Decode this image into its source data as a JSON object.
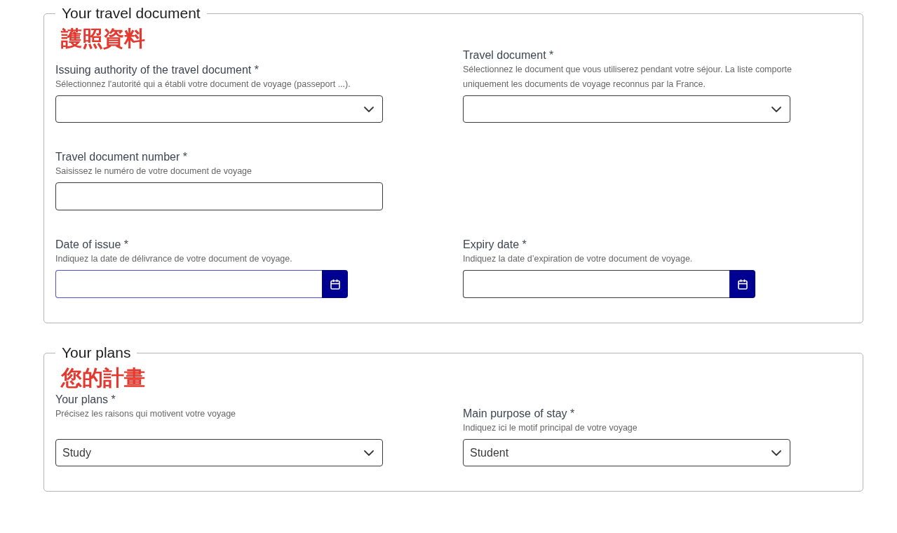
{
  "sections": [
    {
      "legend": "Your travel document",
      "annotation": "護照資料",
      "rows": [
        [
          {
            "kind": "select",
            "label": "Issuing authority of the travel document *",
            "hint": "Sélectionnez l'autorité qui a établi votre document de voyage (passeport ...).",
            "focused": false
          },
          {
            "kind": "select",
            "label": "Travel document *",
            "hint": "Sélectionnez le document que vous utiliserez pendant votre séjour. La liste comporte uniquement les documents de voyage reconnus par la France.",
            "focused": false
          }
        ],
        [
          {
            "kind": "text",
            "label": "Travel document number *",
            "hint": "Saisissez le numéro de votre document de voyage",
            "focused": false
          }
        ],
        [
          {
            "kind": "date",
            "label": "Date of issue *",
            "hint": "Indiquez la date de délivrance de votre document de voyage.",
            "focused": true
          },
          {
            "kind": "date",
            "label": "Expiry date *",
            "hint": "Indiquez la date d’expiration de votre document de voyage.",
            "focused": false
          }
        ]
      ]
    },
    {
      "legend": "Your plans",
      "annotation": "您的計畫",
      "rows": [
        [
          {
            "kind": "select",
            "label": "Your plans *",
            "hint": "Précisez les raisons qui motivent votre voyage",
            "value": "Study",
            "focused": false
          },
          {
            "kind": "select",
            "label": "Main purpose of stay *",
            "hint": "Indiquez ici le motif principal de votre voyage",
            "value": "Student",
            "focused": false
          }
        ]
      ]
    }
  ]
}
